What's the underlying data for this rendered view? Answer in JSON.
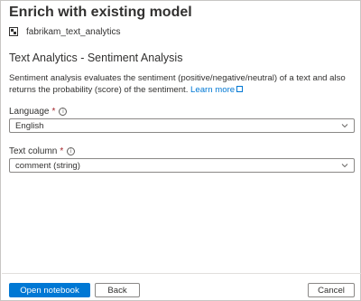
{
  "panel": {
    "title": "Enrich with existing model",
    "model_icon": "model-icon",
    "model_name": "fabrikam_text_analytics"
  },
  "section": {
    "title": "Text Analytics - Sentiment Analysis",
    "description": "Sentiment analysis evaluates the sentiment (positive/negative/neutral) of a text and also returns the probability (score) of the sentiment.",
    "learn_more": "Learn more"
  },
  "fields": {
    "language": {
      "label": "Language",
      "required_mark": "*",
      "value": "English"
    },
    "text_column": {
      "label": "Text column",
      "required_mark": "*",
      "value": "comment (string)"
    }
  },
  "footer": {
    "open_notebook": "Open notebook",
    "back": "Back",
    "cancel": "Cancel"
  },
  "colors": {
    "accent": "#0078d4",
    "required": "#a4262c",
    "border": "#8a8886"
  }
}
